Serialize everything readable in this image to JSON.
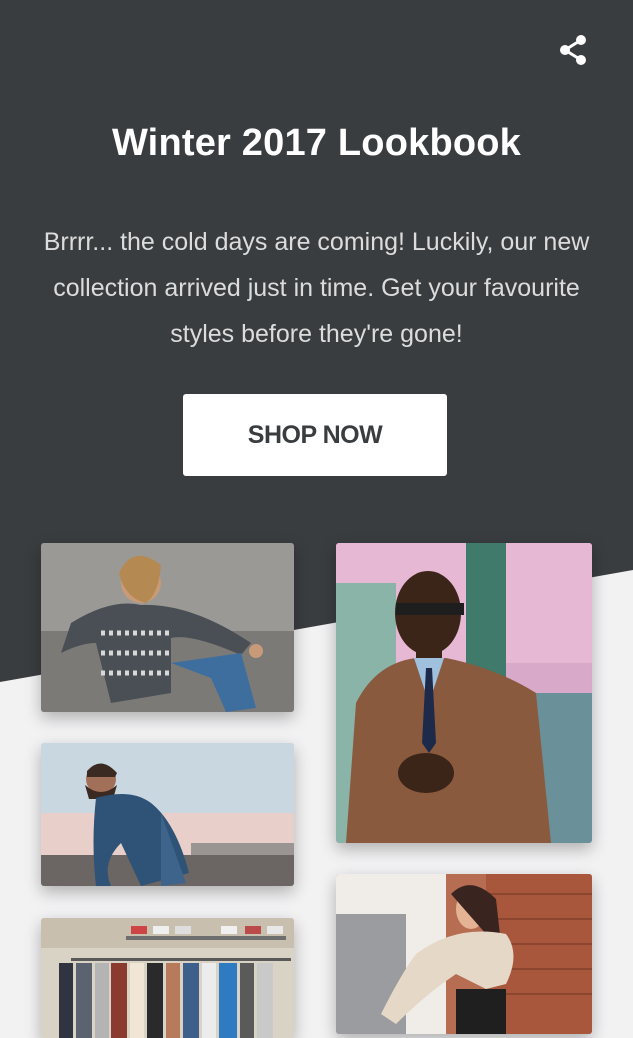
{
  "lookbook": {
    "title": "Winter 2017 Lookbook",
    "description": "Brrrr... the cold days are coming! Luckily, our new collection arrived just in time. Get your favourite styles before they're gone!",
    "cta_label": "SHOP NOW"
  },
  "icons": {
    "share": "share-icon"
  },
  "colors": {
    "hero_background": "#3a3d40",
    "page_background": "#f2f2f3",
    "button_background": "#ffffff",
    "button_text": "#3a3d40",
    "title_text": "#ffffff"
  },
  "gallery": [
    {
      "subject": "woman in patterned knit sweater sitting on concrete"
    },
    {
      "subject": "man in brown leather jacket with sunglasses"
    },
    {
      "subject": "man with beard in denim shirt crouching"
    },
    {
      "subject": "woman in cream cropped sweater near brick wall"
    },
    {
      "subject": "clothing rack with shirts and shoes on shelf"
    }
  ]
}
